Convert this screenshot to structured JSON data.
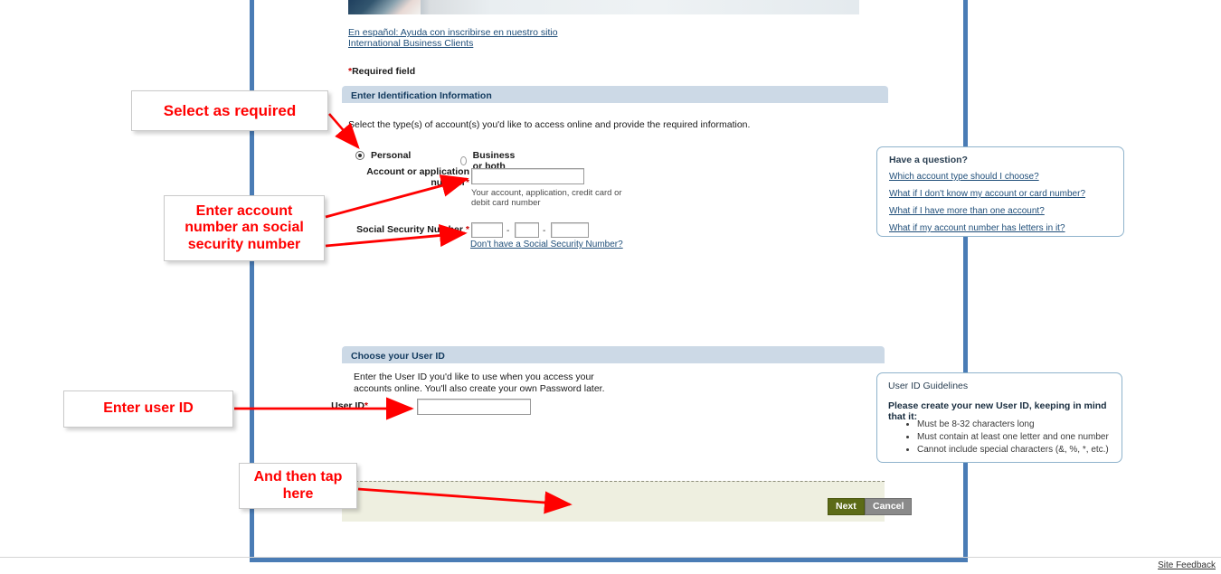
{
  "page": {
    "top_links": [
      "En español: Ayuda con inscribirse en nuestro sitio",
      "International Business Clients"
    ],
    "required_field_note": "Required field",
    "required_star": "*",
    "site_feedback": "Site Feedback"
  },
  "section_identification": {
    "header": "Enter Identification Information",
    "intro": "Select the type(s) of account(s) you'd like to access online and provide the required information.",
    "radio_options": [
      {
        "label": "Personal",
        "selected": true
      },
      {
        "label": "Business or both",
        "selected": false
      }
    ],
    "account_field": {
      "label_line1": "Account or application",
      "label_line2": "number",
      "required_star": "*",
      "value": "",
      "hint_line1": "Your account, application, credit card or",
      "hint_line2": "debit card number"
    },
    "ssn_field": {
      "label": "Social Security Number",
      "required_star": "*",
      "part1": "",
      "part2": "",
      "part3": "",
      "separator": "-",
      "help_link": "Don't have a Social Security Number?"
    },
    "help_box": {
      "title": "Have a question?",
      "links": [
        "Which account type should I choose?",
        "What if I don't know my account or card number?",
        "What if I have more than one account?",
        "What if my account number has letters in it?"
      ]
    }
  },
  "section_userid": {
    "header": "Choose your User ID",
    "intro_line1": "Enter the User ID you'd like to use when you access your",
    "intro_line2": "accounts online. You'll also create your own Password later.",
    "userid_field": {
      "label": "User ID",
      "required_star": "*",
      "value": ""
    },
    "guidelines": {
      "title": "User ID Guidelines",
      "subtitle": "Please create your new User ID, keeping in mind that it:",
      "items": [
        "Must be 8-32 characters long",
        "Must contain at least one letter and one number",
        "Cannot include special characters (&, %, *, etc.)"
      ]
    }
  },
  "footer": {
    "next_label": "Next",
    "cancel_label": "Cancel"
  },
  "annotations": [
    {
      "id": "select",
      "text": "Select as required"
    },
    {
      "id": "account",
      "text": "Enter account number an social security number"
    },
    {
      "id": "userid",
      "text": "Enter user ID"
    },
    {
      "id": "tap",
      "text": "And then tap here"
    }
  ],
  "colors": {
    "annotation_red": "#ff0000",
    "frame_blue": "#4a7cb5",
    "section_header_bg": "#ccd9e6",
    "next_button_bg": "#5c6b17",
    "cancel_button_bg": "#8a8a8a",
    "footer_bg": "#eeefe0",
    "link_blue": "#1f4e79"
  }
}
